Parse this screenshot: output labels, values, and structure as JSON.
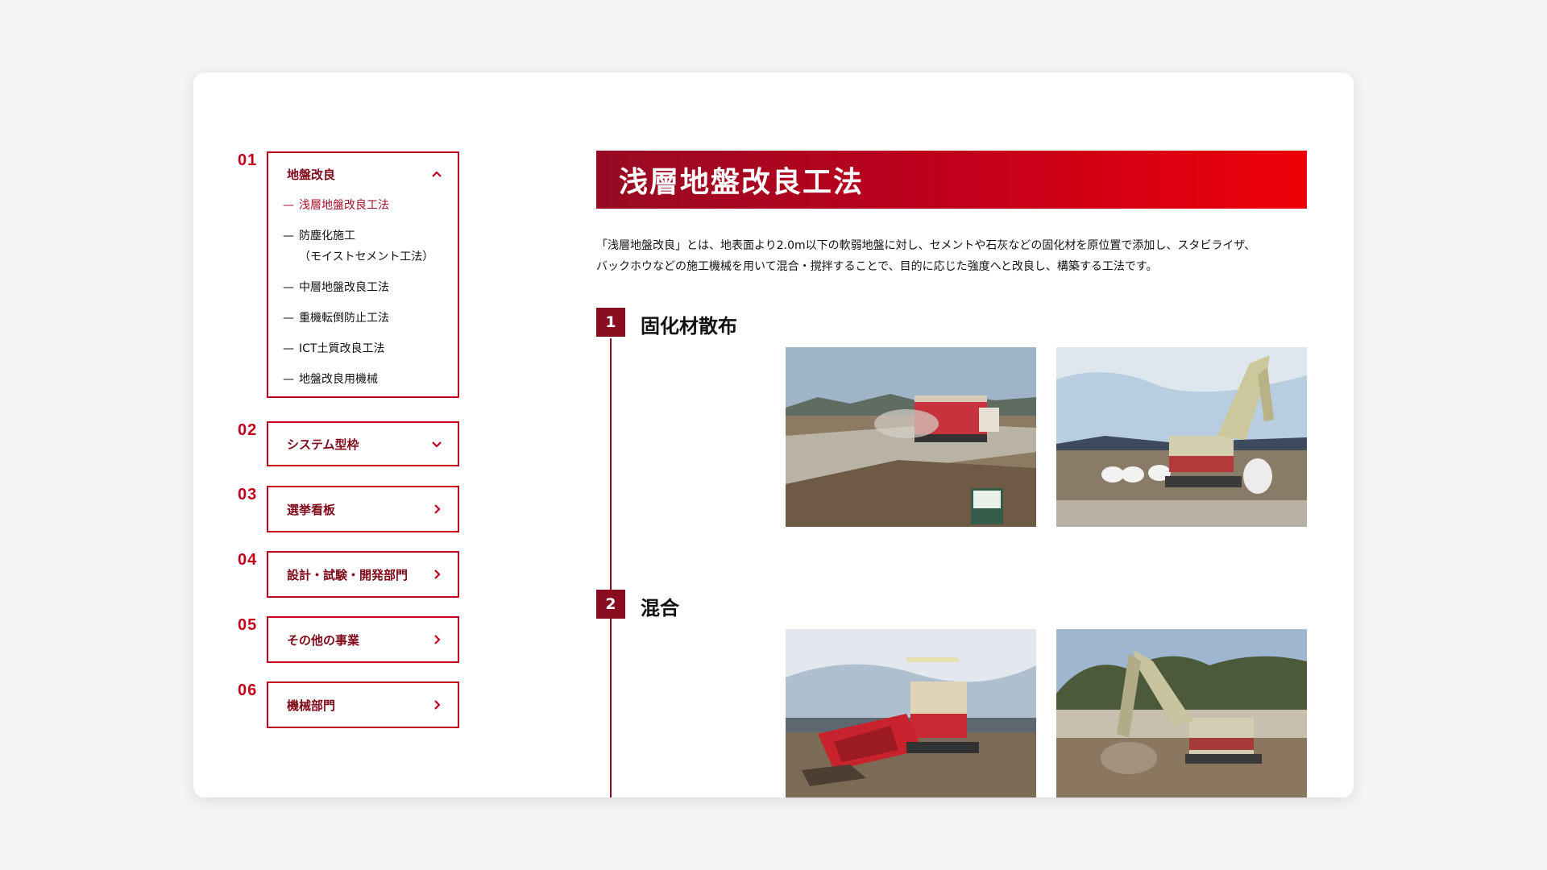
{
  "sidebar": {
    "groups": [
      {
        "num": "01",
        "label": "地盤改良",
        "expanded": true,
        "icon": "chevron-up-icon",
        "items": [
          {
            "label": "浅層地盤改良工法",
            "active": true
          },
          {
            "label": "防塵化施工\n（モイストセメント工法）",
            "active": false
          },
          {
            "label": "中層地盤改良工法",
            "active": false
          },
          {
            "label": "重機転倒防止工法",
            "active": false
          },
          {
            "label": "ICT土質改良工法",
            "active": false
          },
          {
            "label": "地盤改良用機械",
            "active": false
          }
        ]
      },
      {
        "num": "02",
        "label": "システム型枠",
        "expanded": false,
        "icon": "chevron-down-icon"
      },
      {
        "num": "03",
        "label": "選挙看板",
        "expanded": false,
        "icon": "chevron-right-icon"
      },
      {
        "num": "04",
        "label": "設計・試験・開発部門",
        "expanded": false,
        "icon": "chevron-right-icon"
      },
      {
        "num": "05",
        "label": "その他の事業",
        "expanded": false,
        "icon": "chevron-right-icon"
      },
      {
        "num": "06",
        "label": "機械部門",
        "expanded": false,
        "icon": "chevron-right-icon"
      }
    ]
  },
  "main": {
    "title": "浅層地盤改良工法",
    "intro_line1": "「浅層地盤改良」とは、地表面より2.0m以下の軟弱地盤に対し、セメントや石灰などの固化材を原位置で添加し、スタビライザ、",
    "intro_line2": "バックホウなどの施工機械を用いて混合・撹拌することで、目的に応じた強度へと改良し、構築する工法です。",
    "steps": [
      {
        "num": "1",
        "title": "固化材散布",
        "photos": [
          "spreader-truck-photo",
          "excavator-bags-photo"
        ]
      },
      {
        "num": "2",
        "title": "混合",
        "photos": [
          "stabilizer-machine-photo",
          "excavator-mixing-photo"
        ]
      }
    ]
  },
  "colors": {
    "accent": "#c3001b",
    "dark_red": "#8a0c1f",
    "background": "#f4f4f4"
  }
}
